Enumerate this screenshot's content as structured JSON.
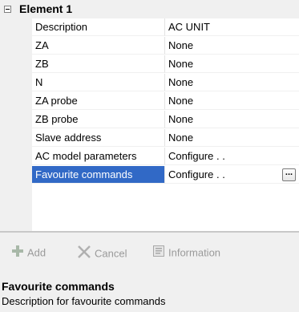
{
  "category": {
    "title": "Element 1",
    "expanded": true
  },
  "properties": [
    {
      "name": "Description",
      "value": "AC UNIT"
    },
    {
      "name": "ZA",
      "value": "None"
    },
    {
      "name": "ZB",
      "value": "None"
    },
    {
      "name": "N",
      "value": "None"
    },
    {
      "name": "ZA probe",
      "value": "None"
    },
    {
      "name": "ZB probe",
      "value": "None"
    },
    {
      "name": "Slave address",
      "value": "None"
    },
    {
      "name": "AC model parameters",
      "value": "Configure . ."
    },
    {
      "name": "Favourite commands",
      "value": "Configure . .",
      "selected": true
    }
  ],
  "ellipsis_button": {
    "label": "..."
  },
  "toolbar": {
    "add_label": "Add",
    "cancel_label": "Cancel",
    "information_label": "Information"
  },
  "description_panel": {
    "title": "Favourite commands",
    "text": "Description for favourite commands"
  },
  "colors": {
    "selection": "#3169c6",
    "panel": "#f0f0f0",
    "disabled_text": "#9a9a9a"
  }
}
